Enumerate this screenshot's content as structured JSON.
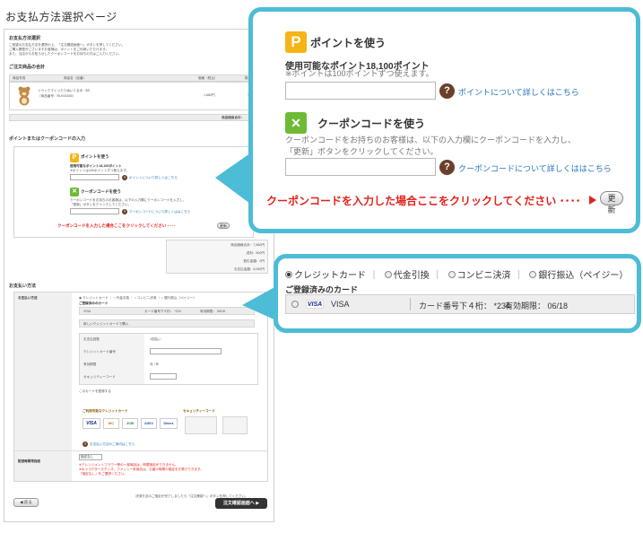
{
  "page": {
    "title": "お支払方法選択ページ"
  },
  "mini": {
    "header": "お支払方法選択",
    "intro_lines": [
      "ご希望のお支払方法を選択の上、「注文確認画面へ」ボタンを押してください。",
      "ご購入履歴がございますお客様は、ポイントをご利用いただけます。",
      "また、当店からお知らせしたクーポンコードをお持ちの方はご入力ください。"
    ],
    "order_section": "ご注文商品の合計",
    "table_headers": [
      "商品写真",
      "商品名（品番）",
      "価格（税込）",
      "数量"
    ],
    "product_name": "リラックマくったりぬいぐるみ（M）",
    "product_code": "（商品番号：RLK00155）",
    "product_price": "1,680円",
    "product_qty": "1個",
    "subtotal_label": "商品価格合計：",
    "point_coupon_section": "ポイントまたはクーポンコードの入力",
    "summary_lines": [
      "商品価格合計：7,560円",
      "送料：500円",
      "割引金額：0円",
      "お支払金額：8,060円"
    ],
    "payment_section": "お支払い方法",
    "payment_label": "お支払い方法",
    "new_card_label": "新しいクレジットカードで購入",
    "card_form_labels": [
      "お支払回数",
      "クレジットカード番号",
      "有効期限",
      "セキュリティーコード"
    ],
    "card_form_values": [
      "1回払い",
      "",
      "月 / 年",
      ""
    ],
    "register_card": "このカードを登録する",
    "card_brands_title": "ご利用可能なクレジットカード",
    "security_title": "セキュリティーコード",
    "card_brands": [
      "VISA",
      "MC",
      "JCB",
      "AMEX",
      "Diners"
    ],
    "help_link": "お支払い方法のご案内はこちら",
    "delivery_label": "配送時間帯指定",
    "delivery_value": "指定なし",
    "notes": [
      "※アレンジメントフラワー等の一部商品は、時間指定ができません。",
      "※キャラクターズグッズ、ファンシー系商品は、お届け時間の指定をお受けできます。",
      "「指定なし」をご選択ください。"
    ],
    "bottom_note": "決済方法のご指定が完了しましたら「注文確認へ」ボタンを押してください。",
    "back_button": "◀ 戻る",
    "next_button": "注文確認画面へ ▶"
  },
  "point": {
    "icon_letter": "P",
    "title": "ポイントを使う",
    "available": "使用可能なポイント18,100ポイント",
    "note": "※ポイントは100ポイントずつ使えます。",
    "input_value": "",
    "link": "ポイントについて詳しくはこちら"
  },
  "coupon": {
    "icon_glyph": "✕",
    "title": "クーポンコードを使う",
    "line1": "クーポンコードをお持ちのお客様は、以下の入力欄にクーポンコードを入力し、",
    "line2": "「更新」ボタンをクリックしてください。",
    "input_value": "",
    "link": "クーポンコードについて詳しくははこちら",
    "prompt": "クーポンコードを入力した場合ここをクリックしてください ････",
    "update_button": "更新"
  },
  "payment": {
    "methods": [
      "クレジットカード",
      "代金引換",
      "コンビニ決済",
      "銀行振込（ペイジー）"
    ],
    "selected_index": 0,
    "saved_title": "ご登録済みのカード",
    "saved_card": {
      "brand_logo": "VISA",
      "brand": "VISA",
      "number": "カード番号下４桁： *234",
      "expiry": "有効期限： 06/18"
    }
  },
  "colors": {
    "callout_border": "#4dbcd6",
    "accent_red": "#e3221c",
    "point_icon": "#f7b416",
    "coupon_icon": "#6fba35",
    "link": "#2777bf",
    "help_icon": "#6b3f2a"
  },
  "icons": {
    "point": "point-p-icon",
    "coupon": "coupon-clover-icon",
    "help": "question-icon",
    "arrow": "triangle-right-icon"
  }
}
